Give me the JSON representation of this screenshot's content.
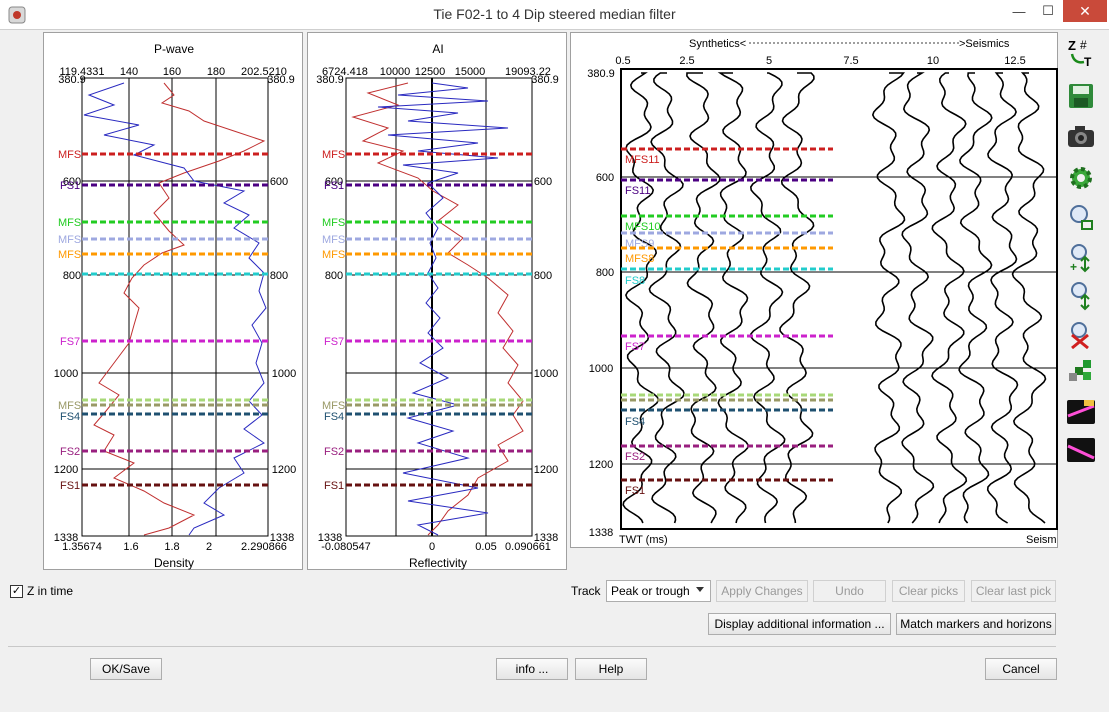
{
  "window": {
    "title": "Tie F02-1 to 4 Dip steered median filter",
    "min_glyph": "—",
    "max_glyph": "☐",
    "close_glyph": "✕"
  },
  "pwave": {
    "top_title": "P-wave",
    "top_ticks": [
      "119.4331",
      "140",
      "160",
      "180",
      "202.5210"
    ],
    "bottom_ticks": [
      "1.35674",
      "1.6",
      "1.8",
      "2",
      "2.290866"
    ],
    "bottom_title": "Density"
  },
  "ai": {
    "top_title": "AI",
    "top_ticks": [
      "6724.418",
      "10000",
      "12500",
      "15000",
      "19093.22"
    ],
    "bottom_ticks": [
      "-0.080547",
      "0",
      "0.05",
      "0.090661"
    ],
    "bottom_title": "Reflectivity"
  },
  "depth_ticks": [
    "380.9",
    "600",
    "800",
    "1000",
    "1200",
    "1338"
  ],
  "markers_short": [
    {
      "label": "MFS",
      "color": "#cc1f1f"
    },
    {
      "label": "FS1",
      "color": "#4b0082"
    },
    {
      "label": "MFS",
      "color": "#22cc22"
    },
    {
      "label": "MFS",
      "color": "#9ea8e0"
    },
    {
      "label": "MFS",
      "color": "#ff9900"
    },
    {
      "label": "",
      "color": "#22cccc"
    },
    {
      "label": "FS7",
      "color": "#cc22cc"
    },
    {
      "label": "",
      "color": "#a8d878"
    },
    {
      "label": "MFS",
      "color": "#999966"
    },
    {
      "label": "FS4",
      "color": "#1f5070"
    },
    {
      "label": "FS2",
      "color": "#991f7f"
    },
    {
      "label": "FS1",
      "color": "#661111"
    }
  ],
  "seis": {
    "top_left": "Synthetics<",
    "top_right": ">Seismics",
    "x_ticks": [
      "0.5",
      "2.5",
      "5",
      "7.5",
      "10",
      "12.5"
    ],
    "time_ticks": [
      "380.9",
      "600",
      "800",
      "1000",
      "1200",
      "1338"
    ],
    "bottom_left": "TWT (ms)",
    "bottom_right": "Seism"
  },
  "seis_markers": [
    {
      "label": "MFS11",
      "color": "#cc1f1f"
    },
    {
      "label": "FS11",
      "color": "#4b0082"
    },
    {
      "label": "MFS10",
      "color": "#22cc22"
    },
    {
      "label": "MFS9",
      "color": "#9ea8e0"
    },
    {
      "label": "MFS8",
      "color": "#ff9900"
    },
    {
      "label": "FS8",
      "color": "#22cccc"
    },
    {
      "label": "FS7",
      "color": "#cc22cc"
    },
    {
      "label": "",
      "color": "#a8d878"
    },
    {
      "label": "",
      "color": "#999966"
    },
    {
      "label": "FS4",
      "color": "#1f5070"
    },
    {
      "label": "FS2",
      "color": "#991f7f"
    },
    {
      "label": "FS1",
      "color": "#661111"
    }
  ],
  "controls": {
    "z_in_time": "Z in time",
    "track_label": "Track",
    "track_value": "Peak or trough",
    "apply_changes": "Apply Changes",
    "undo": "Undo",
    "clear_picks": "Clear picks",
    "clear_last_pick": "Clear last pick",
    "display_info": "Display additional information ...",
    "match_markers": "Match markers and horizons",
    "ok_save": "OK/Save",
    "info": "info ...",
    "help": "Help",
    "cancel": "Cancel"
  }
}
